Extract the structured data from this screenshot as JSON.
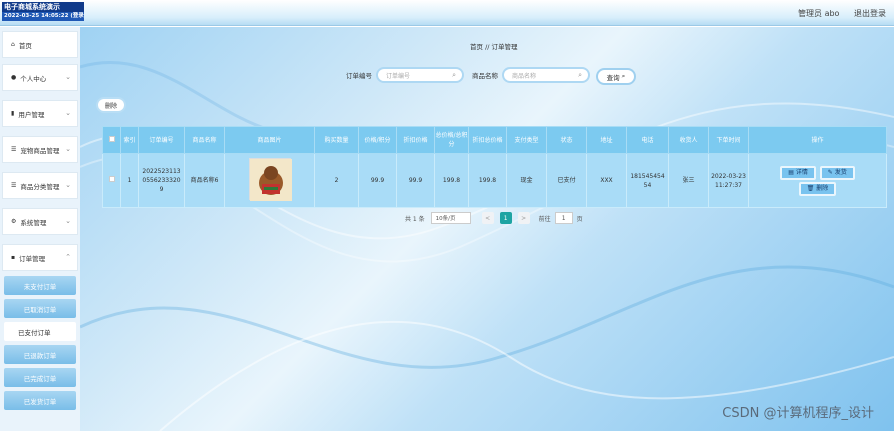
{
  "header": {
    "logo_line1": "电子商城系统演示",
    "logo_line2": "2022-03-25 14:05:22 (登录)",
    "admin_label": "管理员 abo",
    "logout_label": "退出登录"
  },
  "sidebar": {
    "items": [
      {
        "icon": "home-icon",
        "label": "首页"
      },
      {
        "icon": "user-icon",
        "label": "个人中心"
      },
      {
        "icon": "chart-icon",
        "label": "用户管理"
      },
      {
        "icon": "list-icon",
        "label": "宠物商品管理"
      },
      {
        "icon": "list-icon",
        "label": "商品分类管理"
      },
      {
        "icon": "gear-icon",
        "label": "系统管理"
      },
      {
        "icon": "order-icon",
        "label": "订单管理"
      }
    ],
    "sub_items": [
      "未支付订单",
      "已取消订单",
      "已支付订单",
      "已退款订单",
      "已完成订单",
      "已发货订单"
    ],
    "active_sub": "已支付订单"
  },
  "breadcrumb": {
    "home": "首页",
    "sep": "//",
    "current": "订单管理"
  },
  "search": {
    "order_label": "订单编号",
    "order_placeholder": "订单编号",
    "goods_label": "商品名称",
    "goods_placeholder": "商品名称",
    "query_label": "查询"
  },
  "toolbar": {
    "delete_label": "删除"
  },
  "table": {
    "headers": [
      "索引",
      "订单编号",
      "商品名称",
      "商品图片",
      "购买数量",
      "价格/积分",
      "折扣价格",
      "总价格/总积分",
      "折扣总价格",
      "支付类型",
      "状态",
      "地址",
      "电话",
      "收货人",
      "下单时间",
      "操作"
    ],
    "rows": [
      {
        "index": "1",
        "order_no": "2022523113055623332​09",
        "goods_name": "商品名称6",
        "qty": "2",
        "price": "99.9",
        "discount": "99.9",
        "total": "199.8",
        "discount_total": "199.8",
        "pay_type": "现金",
        "status": "已支付",
        "address": "XXX",
        "phone": "18154545454",
        "receiver": "张三",
        "time": "2022-03-23 11:27:37"
      }
    ],
    "actions": {
      "detail": "详情",
      "ship": "发货",
      "delete": "删除"
    }
  },
  "pagination": {
    "total": "共 1 条",
    "page_size": "10条/页",
    "prev": "<",
    "page": "1",
    "next": ">",
    "goto_label": "前往",
    "goto_value": "1",
    "page_suffix": "页"
  },
  "watermark": "CSDN @计算机程序_设计"
}
